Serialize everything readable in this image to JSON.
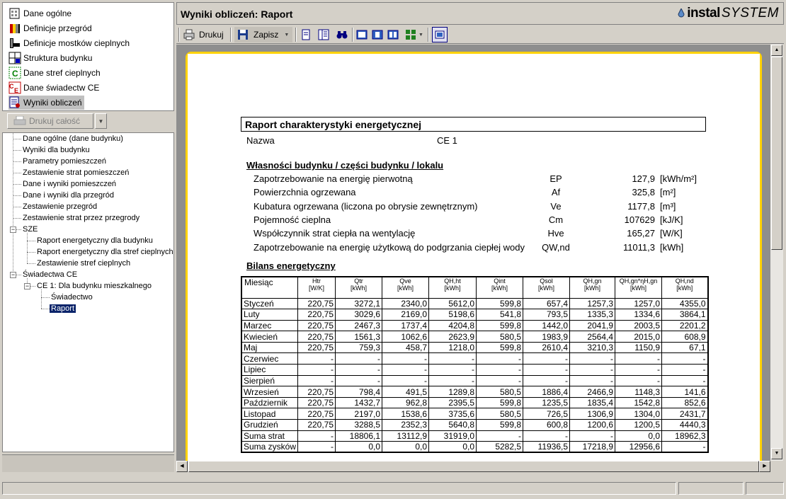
{
  "nav": {
    "items": [
      {
        "label": "Dane ogólne",
        "icon": "building-info-icon"
      },
      {
        "label": "Definicje przegród",
        "icon": "wall-layers-icon"
      },
      {
        "label": "Definicje mostków cieplnych",
        "icon": "thermal-bridge-icon"
      },
      {
        "label": "Struktura budynku",
        "icon": "building-structure-icon"
      },
      {
        "label": "Dane stref cieplnych",
        "icon": "heat-zone-icon"
      },
      {
        "label": "Dane świadectw CE",
        "icon": "certificate-ce-icon"
      },
      {
        "label": "Wyniki obliczeń",
        "icon": "calculation-results-icon"
      }
    ]
  },
  "print_all": {
    "label": "Drukuj całość"
  },
  "tree": {
    "nodes": [
      "Dane ogólne (dane budynku)",
      "Wyniki dla budynku",
      "Parametry pomieszczeń",
      "Zestawienie strat pomieszczeń",
      "Dane i wyniki pomieszczeń",
      "Dane i wyniki dla przegród",
      "Zestawienie przegród",
      "Zestawienie strat przez przegrody",
      "SZE",
      "Raport energetyczny dla budynku",
      "Raport energetyczny dla stref cieplnych",
      "Zestawienie stref cieplnych",
      "Świadectwa CE",
      "CE 1: Dla budynku mieszkalnego",
      "Świadectwo",
      "Raport"
    ]
  },
  "header": {
    "title": "Wyniki obliczeń: Raport",
    "logo_part1": "instal",
    "logo_part2": "SYSTEM"
  },
  "toolbar": {
    "print_label": "Drukuj",
    "save_label": "Zapisz"
  },
  "report": {
    "title": "Raport charakterystyki energetycznej",
    "name_label": "Nazwa",
    "name_value": "CE 1",
    "props_heading": "Własności budynku / części budynku / lokalu",
    "properties": [
      {
        "label": "Zapotrzebowanie na energię pierwotną",
        "symbol": "EP",
        "value": "127,9",
        "unit": "[kWh/m²]"
      },
      {
        "label": "Powierzchnia ogrzewana",
        "symbol": "Af",
        "value": "325,8",
        "unit": "[m²]"
      },
      {
        "label": "Kubatura ogrzewana (liczona po obrysie zewnętrznym)",
        "symbol": "Ve",
        "value": "1177,8",
        "unit": "[m³]"
      },
      {
        "label": "Pojemność cieplna",
        "symbol": "Cm",
        "value": "107629",
        "unit": "[kJ/K]"
      },
      {
        "label": "Współczynnik strat ciepła na wentylację",
        "symbol": "Hve",
        "value": "165,27",
        "unit": "[W/K]"
      },
      {
        "label": "Zapotrzebowanie na energię użytkową do podgrzania ciepłej wody",
        "symbol": "QW,nd",
        "value": "11011,3",
        "unit": "[kWh]"
      }
    ],
    "bilans_heading": "Bilans energetyczny",
    "table": {
      "headers": [
        {
          "l1": "Miesiąc",
          "l2": ""
        },
        {
          "l1": "Htr",
          "l2": "[W/K]"
        },
        {
          "l1": "Qtr",
          "l2": "[kWh]"
        },
        {
          "l1": "Qve",
          "l2": "[kWh]"
        },
        {
          "l1": "QH,ht",
          "l2": "[kWh]"
        },
        {
          "l1": "Qint",
          "l2": "[kWh]"
        },
        {
          "l1": "Qsol",
          "l2": "[kWh]"
        },
        {
          "l1": "QH,gn",
          "l2": "[kWh]"
        },
        {
          "l1": "QH,gn*ηH,gn",
          "l2": "[kWh]"
        },
        {
          "l1": "QH,nd",
          "l2": "[kWh]"
        }
      ],
      "rows": [
        [
          "Styczeń",
          "220,75",
          "3272,1",
          "2340,0",
          "5612,0",
          "599,8",
          "657,4",
          "1257,3",
          "1257,0",
          "4355,0"
        ],
        [
          "Luty",
          "220,75",
          "3029,6",
          "2169,0",
          "5198,6",
          "541,8",
          "793,5",
          "1335,3",
          "1334,6",
          "3864,1"
        ],
        [
          "Marzec",
          "220,75",
          "2467,3",
          "1737,4",
          "4204,8",
          "599,8",
          "1442,0",
          "2041,9",
          "2003,5",
          "2201,2"
        ],
        [
          "Kwiecień",
          "220,75",
          "1561,3",
          "1062,6",
          "2623,9",
          "580,5",
          "1983,9",
          "2564,4",
          "2015,0",
          "608,9"
        ],
        [
          "Maj",
          "220,75",
          "759,3",
          "458,7",
          "1218,0",
          "599,8",
          "2610,4",
          "3210,3",
          "1150,9",
          "67,1"
        ],
        [
          "Czerwiec",
          "-",
          "-",
          "-",
          "-",
          "-",
          "-",
          "-",
          "-",
          "-"
        ],
        [
          "Lipiec",
          "-",
          "-",
          "-",
          "-",
          "-",
          "-",
          "-",
          "-",
          "-"
        ],
        [
          "Sierpień",
          "-",
          "-",
          "-",
          "-",
          "-",
          "-",
          "-",
          "-",
          "-"
        ],
        [
          "Wrzesień",
          "220,75",
          "798,4",
          "491,5",
          "1289,8",
          "580,5",
          "1886,4",
          "2466,9",
          "1148,3",
          "141,6"
        ],
        [
          "Październik",
          "220,75",
          "1432,7",
          "962,8",
          "2395,5",
          "599,8",
          "1235,5",
          "1835,4",
          "1542,8",
          "852,6"
        ],
        [
          "Listopad",
          "220,75",
          "2197,0",
          "1538,6",
          "3735,6",
          "580,5",
          "726,5",
          "1306,9",
          "1304,0",
          "2431,7"
        ],
        [
          "Grudzień",
          "220,75",
          "3288,5",
          "2352,3",
          "5640,8",
          "599,8",
          "600,8",
          "1200,6",
          "1200,5",
          "4440,3"
        ],
        [
          "Suma strat",
          "-",
          "18806,1",
          "13112,9",
          "31919,0",
          "-",
          "-",
          "-",
          "0,0",
          "18962,3"
        ],
        [
          "Suma zysków",
          "-",
          "0,0",
          "0,0",
          "0,0",
          "5282,5",
          "11936,5",
          "17218,9",
          "12956,6",
          "-"
        ]
      ]
    }
  }
}
